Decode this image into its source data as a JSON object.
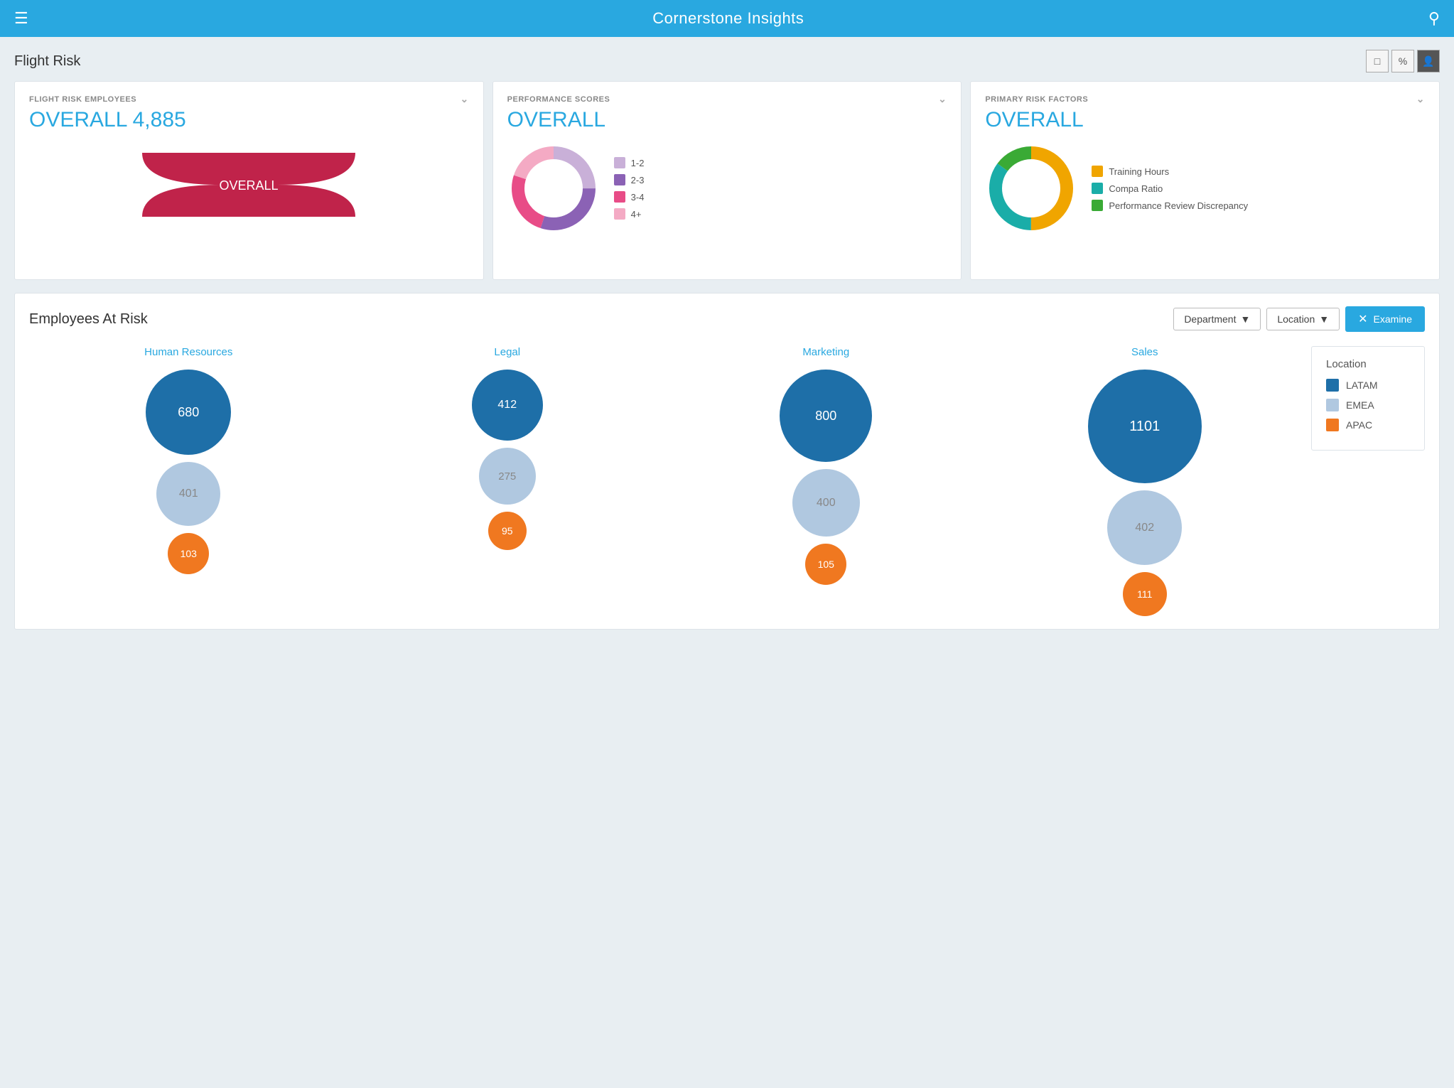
{
  "header": {
    "title": "Cornerstone Insights",
    "menu_icon": "☰",
    "search_icon": "🔍"
  },
  "flight_risk": {
    "title": "Flight Risk",
    "controls": [
      "□",
      "%",
      "👤"
    ],
    "cards": [
      {
        "id": "flight-risk-employees",
        "label": "FLIGHT RISK EMPLOYEES",
        "value": "OVERALL 4,885",
        "type": "funnel",
        "funnel_label": "OVERALL"
      },
      {
        "id": "performance-scores",
        "label": "PERFORMANCE SCORES",
        "value": "OVERALL",
        "type": "donut",
        "donut_colors": [
          "#c9b0d8",
          "#8b62b5",
          "#e84c87",
          "#f4aac4"
        ],
        "legend": [
          {
            "label": "1-2",
            "color": "#c9b0d8"
          },
          {
            "label": "2-3",
            "color": "#8b62b5"
          },
          {
            "label": "3-4",
            "color": "#e84c87"
          },
          {
            "label": "4+",
            "color": "#f4aac4"
          }
        ],
        "segments": [
          25,
          30,
          25,
          20
        ]
      },
      {
        "id": "primary-risk-factors",
        "label": "PRIMARY RISK FACTORS",
        "value": "OVERALL",
        "type": "donut",
        "donut_colors": [
          "#f0a500",
          "#1aada8",
          "#3aaa35"
        ],
        "legend": [
          {
            "label": "Training Hours",
            "color": "#f0a500"
          },
          {
            "label": "Compa Ratio",
            "color": "#1aada8"
          },
          {
            "label": "Performance Review Discrepancy",
            "color": "#3aaa35"
          }
        ],
        "segments": [
          50,
          35,
          15
        ]
      }
    ]
  },
  "employees_at_risk": {
    "title": "Employees At Risk",
    "filter1": "Department",
    "filter2": "Location",
    "examine_label": "Examine",
    "departments": [
      {
        "name": "Human Resources",
        "bubbles": [
          {
            "value": 680,
            "size": 120,
            "color": "#1e6fa8"
          },
          {
            "value": 401,
            "size": 90,
            "color": "#b0c8e0"
          },
          {
            "value": 103,
            "size": 58,
            "color": "#f07820"
          }
        ]
      },
      {
        "name": "Legal",
        "bubbles": [
          {
            "value": 412,
            "size": 100,
            "color": "#1e6fa8"
          },
          {
            "value": 275,
            "size": 80,
            "color": "#b0c8e0"
          },
          {
            "value": 95,
            "size": 54,
            "color": "#f07820"
          }
        ]
      },
      {
        "name": "Marketing",
        "bubbles": [
          {
            "value": 800,
            "size": 130,
            "color": "#1e6fa8"
          },
          {
            "value": 400,
            "size": 95,
            "color": "#b0c8e0"
          },
          {
            "value": 105,
            "size": 58,
            "color": "#f07820"
          }
        ]
      },
      {
        "name": "Sales",
        "bubbles": [
          {
            "value": 1101,
            "size": 160,
            "color": "#1e6fa8"
          },
          {
            "value": 402,
            "size": 105,
            "color": "#b0c8e0"
          },
          {
            "value": 111,
            "size": 62,
            "color": "#f07820"
          }
        ]
      }
    ],
    "legend": {
      "title": "Location",
      "items": [
        {
          "label": "LATAM",
          "color": "#1e6fa8"
        },
        {
          "label": "EMEA",
          "color": "#b0c8e0"
        },
        {
          "label": "APAC",
          "color": "#f07820"
        }
      ]
    }
  }
}
